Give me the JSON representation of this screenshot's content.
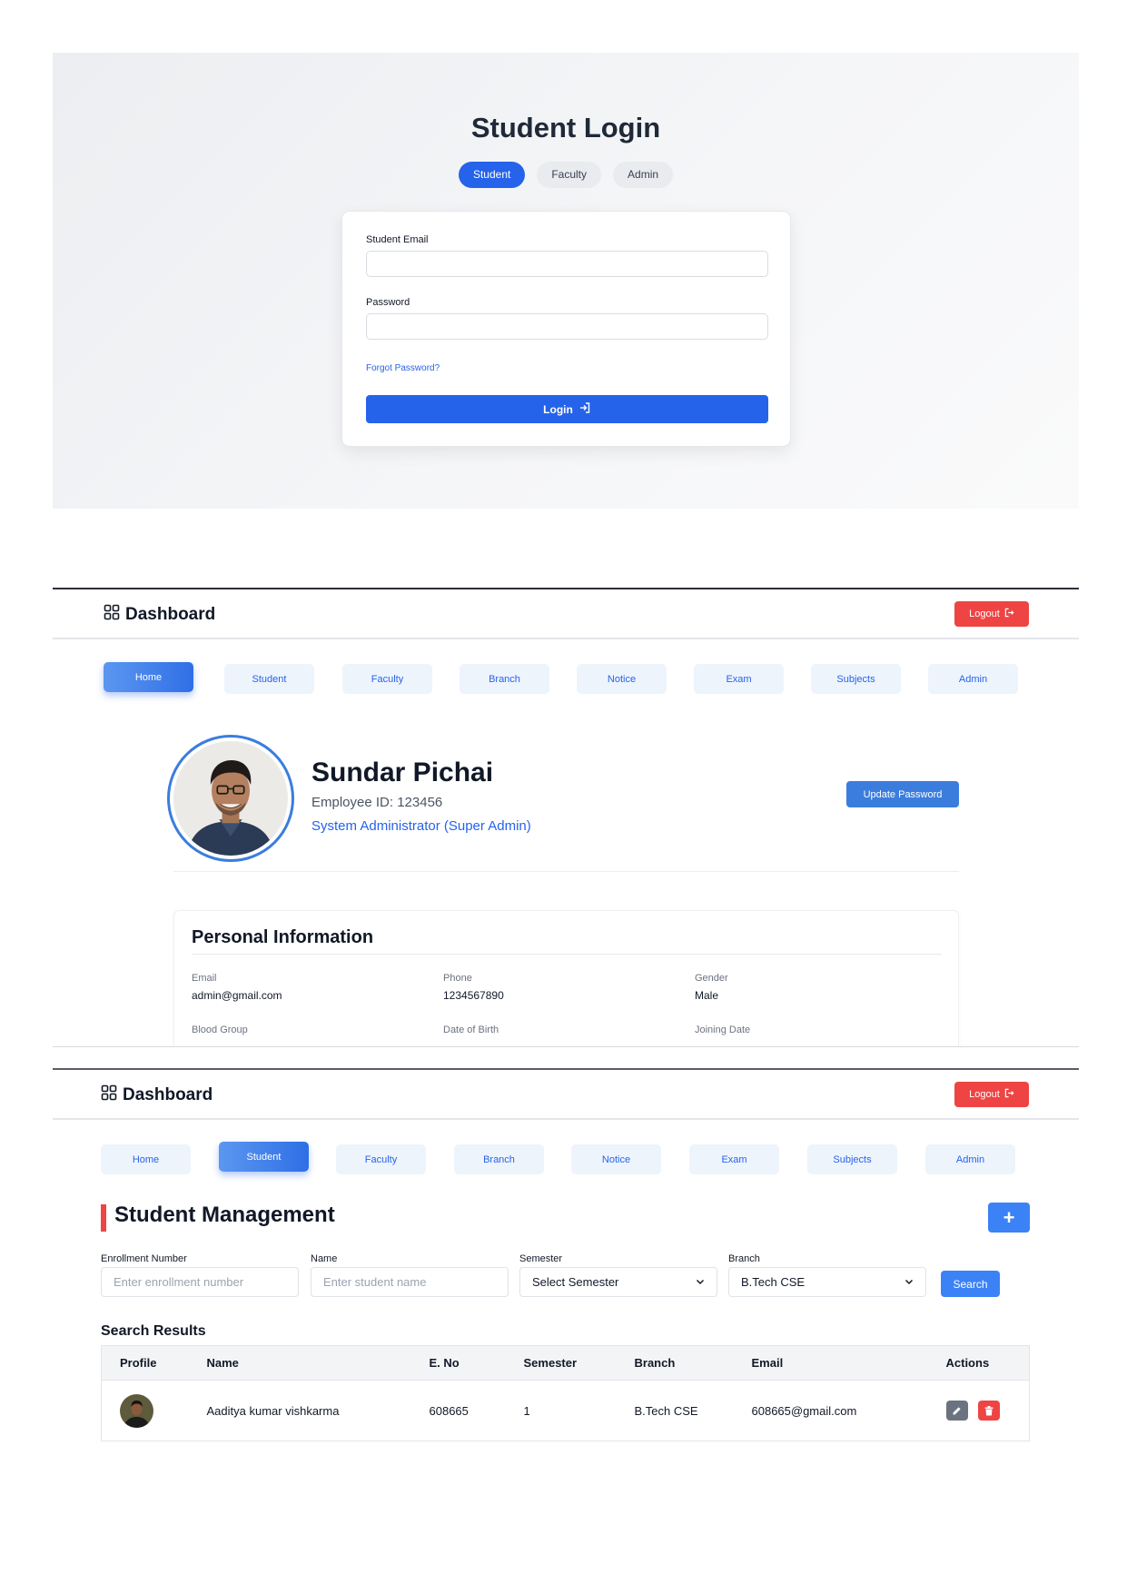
{
  "login": {
    "title": "Student Login",
    "roles": [
      "Student",
      "Faculty",
      "Admin"
    ],
    "active_role": "Student",
    "email_label": "Student Email",
    "email_value": "",
    "password_label": "Password",
    "password_value": "",
    "forgot_label": "Forgot Password?",
    "login_label": "Login",
    "accent_color": "#2563eb"
  },
  "dashboard": {
    "title": "Dashboard",
    "logout_label": "Logout",
    "nav": [
      "Home",
      "Student",
      "Faculty",
      "Branch",
      "Notice",
      "Exam",
      "Subjects",
      "Admin"
    ],
    "logout_color": "#ef4444"
  },
  "profile": {
    "name": "Sundar Pichai",
    "employee_id": "Employee ID: 123456",
    "role": "System Administrator (Super Admin)",
    "update_password_label": "Update Password",
    "personal_info_title": "Personal Information",
    "fields": [
      {
        "label": "Email",
        "value": "admin@gmail.com"
      },
      {
        "label": "Phone",
        "value": "1234567890"
      },
      {
        "label": "Gender",
        "value": "Male"
      },
      {
        "label": "Blood Group",
        "value": ""
      },
      {
        "label": "Date of Birth",
        "value": ""
      },
      {
        "label": "Joining Date",
        "value": ""
      }
    ]
  },
  "student_management": {
    "title": "Student Management",
    "add_label": "+",
    "filters": {
      "enrollment_label": "Enrollment Number",
      "enrollment_placeholder": "Enter enrollment number",
      "name_label": "Name",
      "name_placeholder": "Enter student name",
      "semester_label": "Semester",
      "semester_value": "Select Semester",
      "branch_label": "Branch",
      "branch_value": "B.Tech CSE",
      "search_label": "Search"
    },
    "results_title": "Search Results",
    "columns": [
      "Profile",
      "Name",
      "E. No",
      "Semester",
      "Branch",
      "Email",
      "Actions"
    ],
    "rows": [
      {
        "name": "Aaditya kumar vishkarma",
        "enrollment": "608665",
        "semester": "1",
        "branch": "B.Tech CSE",
        "email": "608665@gmail.com"
      }
    ]
  }
}
